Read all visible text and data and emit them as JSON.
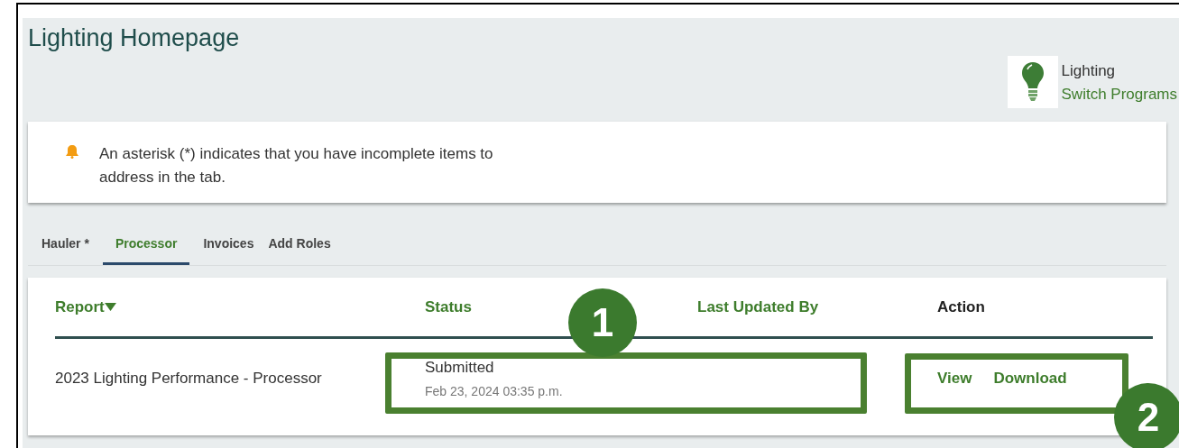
{
  "page": {
    "title": "Lighting Homepage"
  },
  "program": {
    "name": "Lighting",
    "link": "Switch Programs"
  },
  "notice": {
    "text": "An asterisk (*) indicates that you have incomplete items to address in the tab."
  },
  "tabs": [
    {
      "label": "Hauler *",
      "selected": false
    },
    {
      "label": "Processor",
      "selected": true
    },
    {
      "label": "Invoices",
      "selected": false
    },
    {
      "label": "Add Roles",
      "selected": false
    }
  ],
  "table": {
    "columns": [
      {
        "label": "Report",
        "sortable": true,
        "sorted": true
      },
      {
        "label": "Status",
        "sortable": true,
        "sorted": false
      },
      {
        "label": "Last Updated By",
        "sortable": true,
        "sorted": false
      },
      {
        "label": "Action",
        "sortable": false,
        "sorted": false
      }
    ],
    "rows": [
      {
        "report": "2023 Lighting Performance - Processor",
        "status": "Submitted",
        "date": "Feb 23, 2024 03:35 p.m.",
        "actions": [
          "View",
          "Download"
        ]
      }
    ]
  },
  "callouts": [
    {
      "number": "1"
    },
    {
      "number": "2"
    }
  ]
}
